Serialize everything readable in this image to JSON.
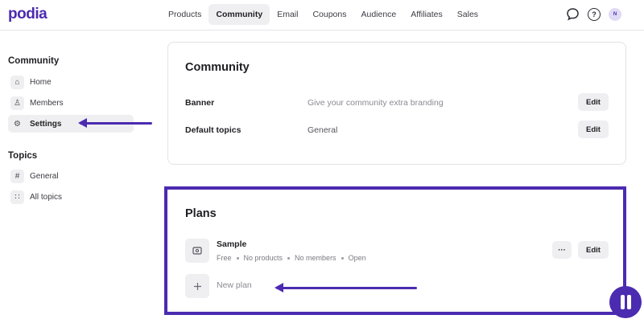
{
  "app": {
    "logo": "podia"
  },
  "nav": {
    "items": [
      {
        "label": "Products",
        "active": false
      },
      {
        "label": "Community",
        "active": true
      },
      {
        "label": "Email",
        "active": false
      },
      {
        "label": "Coupons",
        "active": false
      },
      {
        "label": "Audience",
        "active": false
      },
      {
        "label": "Affiliates",
        "active": false
      },
      {
        "label": "Sales",
        "active": false
      }
    ],
    "icons": [
      "chat-bubble-icon",
      "help-icon",
      "avatar"
    ],
    "avatar_initial": "N"
  },
  "sidebar": {
    "community_heading": "Community",
    "community_items": [
      {
        "label": "Home",
        "icon": "home-icon",
        "glyph": "⌂"
      },
      {
        "label": "Members",
        "icon": "member-icon",
        "glyph": "♙"
      },
      {
        "label": "Settings",
        "icon": "gear-icon",
        "glyph": "⚙",
        "active": true
      }
    ],
    "topics_heading": "Topics",
    "topics_items": [
      {
        "label": "General",
        "icon": "hash-icon",
        "glyph": "#"
      },
      {
        "label": "All topics",
        "icon": "grid-icon",
        "glyph": "∷"
      }
    ]
  },
  "community_card": {
    "title": "Community",
    "rows": [
      {
        "label": "Banner",
        "value": "Give your community extra branding",
        "button": "Edit"
      },
      {
        "label": "Default topics",
        "value": "General",
        "button": "Edit"
      }
    ]
  },
  "plans_card": {
    "title": "Plans",
    "plan": {
      "name": "Sample",
      "meta": [
        "Free",
        "No products",
        "No members",
        "Open"
      ],
      "more_label": "···",
      "edit_label": "Edit"
    },
    "new_plan_label": "New plan"
  },
  "colors": {
    "accent": "#4b2bb0",
    "button_bg": "#efeff2",
    "border": "#e3e3e8"
  }
}
